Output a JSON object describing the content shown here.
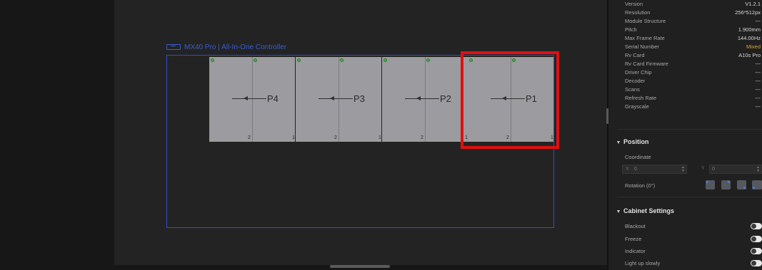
{
  "controller": {
    "label": "MX40 Pro | All-In-One Controller",
    "frame_color": "#2f4ecc",
    "icon": "controller-icon"
  },
  "cabinets": [
    {
      "port": "P4",
      "left_num": "2",
      "right_num": "1"
    },
    {
      "port": "P3",
      "left_num": "2",
      "right_num": "1"
    },
    {
      "port": "P2",
      "left_num": "2",
      "right_num": "1"
    },
    {
      "port": "P1",
      "left_num": "2",
      "right_num": "1"
    }
  ],
  "highlight": {
    "target": "P1",
    "color": "#e01010"
  },
  "properties": [
    {
      "label": "Version",
      "value": "V1.2.1"
    },
    {
      "label": "Resolution",
      "value": "256*512px"
    },
    {
      "label": "Module Structure",
      "value": "---"
    },
    {
      "label": "Pitch",
      "value": "1.900mm"
    },
    {
      "label": "Max Frame Rate",
      "value": "144.00Hz"
    },
    {
      "label": "Serial Number",
      "value": "Mixed"
    },
    {
      "label": "Rv Card",
      "value": "A10s Pro"
    },
    {
      "label": "Rv Card Firmware",
      "value": "---"
    },
    {
      "label": "Driver Chip",
      "value": "---"
    },
    {
      "label": "Decoder",
      "value": "---"
    },
    {
      "label": "Scans",
      "value": "---"
    },
    {
      "label": "Refresh Rate",
      "value": "---"
    },
    {
      "label": "Grayscale",
      "value": "---"
    }
  ],
  "position": {
    "title": "Position",
    "coordinate_label": "Coordinate",
    "x_label": "X",
    "x_value": "0",
    "y_label": "Y",
    "y_value": "0",
    "rotation_label": "Rotation (0°)"
  },
  "cabinet_settings": {
    "title": "Cabinet Settings",
    "items": [
      {
        "label": "Blackout",
        "on": false
      },
      {
        "label": "Freeze",
        "on": false
      },
      {
        "label": "Indicator",
        "on": false
      },
      {
        "label": "Light up slowly",
        "on": false
      }
    ]
  },
  "colors": {
    "mixed_value": "#d9a530",
    "dot_green": "#46b346"
  }
}
